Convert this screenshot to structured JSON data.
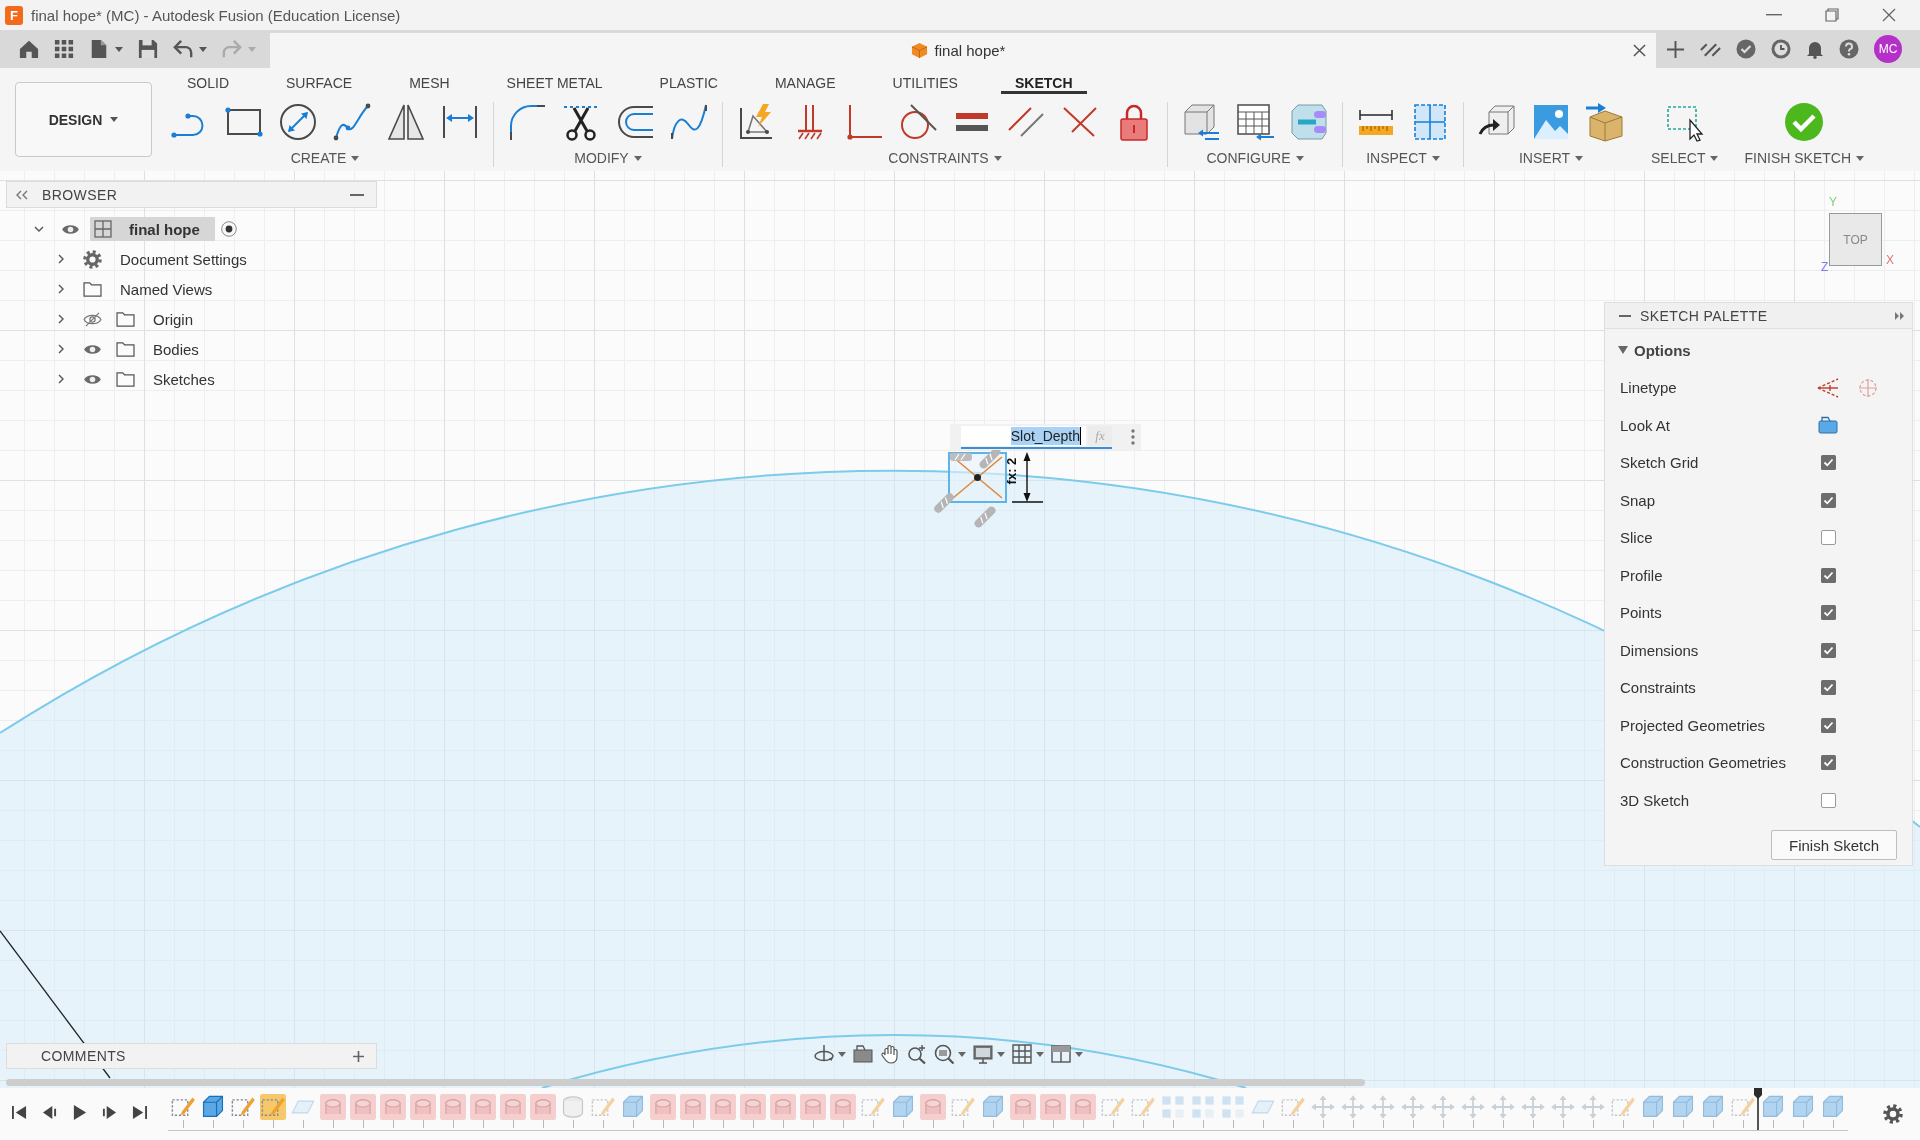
{
  "window": {
    "app_icon": "F",
    "title": "final hope* (MC) - Autodesk Fusion (Education License)"
  },
  "quick_access": [
    {
      "kind": "home",
      "dropdown": false,
      "disabled": false
    },
    {
      "kind": "apps",
      "dropdown": false,
      "disabled": false
    },
    {
      "kind": "file",
      "dropdown": true,
      "disabled": false
    },
    {
      "kind": "save",
      "dropdown": false,
      "disabled": false
    },
    {
      "kind": "undo",
      "dropdown": true,
      "disabled": false
    },
    {
      "kind": "redo",
      "dropdown": true,
      "disabled": true
    }
  ],
  "document_tab": {
    "title": "final hope*"
  },
  "user": {
    "initials": "MC"
  },
  "workspace": {
    "label": "DESIGN"
  },
  "tabs": [
    {
      "label": "SOLID",
      "selected": false
    },
    {
      "label": "SURFACE",
      "selected": false
    },
    {
      "label": "MESH",
      "selected": false
    },
    {
      "label": "SHEET METAL",
      "selected": false
    },
    {
      "label": "PLASTIC",
      "selected": false
    },
    {
      "label": "MANAGE",
      "selected": false
    },
    {
      "label": "UTILITIES",
      "selected": false
    },
    {
      "label": "SKETCH",
      "selected": true
    }
  ],
  "tool_groups": [
    {
      "label": "CREATE",
      "tools": [
        {
          "kind": "line"
        },
        {
          "kind": "rectangle"
        },
        {
          "kind": "circle"
        },
        {
          "kind": "spline"
        },
        {
          "kind": "mirror"
        },
        {
          "kind": "dimension"
        }
      ]
    },
    {
      "label": "MODIFY",
      "tools": [
        {
          "kind": "fillet"
        },
        {
          "kind": "trim"
        },
        {
          "kind": "offset"
        },
        {
          "kind": "conic"
        }
      ]
    },
    {
      "label": "CONSTRAINTS",
      "tools": [
        {
          "kind": "auto-constrain"
        },
        {
          "kind": "fix-hatch"
        },
        {
          "kind": "corner"
        },
        {
          "kind": "tangent"
        },
        {
          "kind": "equal"
        },
        {
          "kind": "parallel"
        },
        {
          "kind": "perpendicular"
        },
        {
          "kind": "lock"
        }
      ]
    },
    {
      "label": "CONFIGURE",
      "tools": [
        {
          "kind": "configure-cube"
        },
        {
          "kind": "table"
        },
        {
          "kind": "configurator"
        }
      ]
    },
    {
      "label": "INSPECT",
      "tools": [
        {
          "kind": "measure"
        },
        {
          "kind": "section"
        }
      ]
    },
    {
      "label": "INSERT",
      "tools": [
        {
          "kind": "derive"
        },
        {
          "kind": "canvas"
        },
        {
          "kind": "insert-box"
        }
      ]
    },
    {
      "label": "SELECT",
      "tools": [
        {
          "kind": "select"
        }
      ]
    },
    {
      "label": "FINISH SKETCH",
      "tools": [
        {
          "kind": "finish"
        }
      ]
    }
  ],
  "browser": {
    "title": "BROWSER",
    "tree": [
      {
        "label": "final hope",
        "kind": "component",
        "visible": true,
        "expanded": true,
        "active": true,
        "children": [
          {
            "label": "Document Settings",
            "kind": "settings",
            "expanded": false
          },
          {
            "label": "Named Views",
            "kind": "folder",
            "expanded": false
          },
          {
            "label": "Origin",
            "kind": "folder",
            "visible": false,
            "expanded": false
          },
          {
            "label": "Bodies",
            "kind": "folder",
            "visible": true,
            "expanded": false
          },
          {
            "label": "Sketches",
            "kind": "folder",
            "visible": true,
            "expanded": false
          }
        ]
      }
    ]
  },
  "view_cube": {
    "face": "TOP",
    "x_axis": "X",
    "y_axis": "Y",
    "z_axis": "Z"
  },
  "dimension_input": {
    "value": "Slot_Depth",
    "function_button": "fx"
  },
  "sketch_dimension": {
    "text": "fx: 2"
  },
  "sketch_palette": {
    "title": "SKETCH PALETTE",
    "section": {
      "label": "Options",
      "expanded": true
    },
    "rows": [
      {
        "kind": "linetype",
        "label": "Linetype"
      },
      {
        "kind": "look-at",
        "label": "Look At"
      },
      {
        "kind": "checkbox",
        "label": "Sketch Grid",
        "checked": true
      },
      {
        "kind": "checkbox",
        "label": "Snap",
        "checked": true
      },
      {
        "kind": "checkbox",
        "label": "Slice",
        "checked": false
      },
      {
        "kind": "checkbox",
        "label": "Profile",
        "checked": true
      },
      {
        "kind": "checkbox",
        "label": "Points",
        "checked": true
      },
      {
        "kind": "checkbox",
        "label": "Dimensions",
        "checked": true
      },
      {
        "kind": "checkbox",
        "label": "Constraints",
        "checked": true
      },
      {
        "kind": "checkbox",
        "label": "Projected Geometries",
        "checked": true
      },
      {
        "kind": "checkbox",
        "label": "Construction Geometries",
        "checked": true
      },
      {
        "kind": "checkbox",
        "label": "3D Sketch",
        "checked": false
      }
    ],
    "button": "Finish Sketch"
  },
  "comments": {
    "title": "COMMENTS"
  },
  "timeline": {
    "items": [
      {
        "kind": "sketch",
        "selected": false,
        "error": false
      },
      {
        "kind": "extrude",
        "selected": false,
        "error": false
      },
      {
        "kind": "sketch",
        "selected": false,
        "error": false
      },
      {
        "kind": "sketch",
        "selected": true,
        "error": false
      },
      {
        "kind": "plane",
        "selected": false,
        "error": false
      },
      {
        "kind": "revolve",
        "selected": false,
        "error": true
      },
      {
        "kind": "revolve",
        "selected": false,
        "error": true
      },
      {
        "kind": "revolve",
        "selected": false,
        "error": true
      },
      {
        "kind": "revolve",
        "selected": false,
        "error": true
      },
      {
        "kind": "revolve",
        "selected": false,
        "error": true
      },
      {
        "kind": "revolve",
        "selected": false,
        "error": true
      },
      {
        "kind": "revolve",
        "selected": false,
        "error": true
      },
      {
        "kind": "revolve",
        "selected": false,
        "error": true
      },
      {
        "kind": "hole",
        "selected": false,
        "error": false
      },
      {
        "kind": "sketch",
        "selected": false,
        "error": false
      },
      {
        "kind": "extrude",
        "selected": false,
        "error": false
      },
      {
        "kind": "revolve",
        "selected": false,
        "error": true
      },
      {
        "kind": "revolve",
        "selected": false,
        "error": true
      },
      {
        "kind": "revolve",
        "selected": false,
        "error": true
      },
      {
        "kind": "revolve",
        "selected": false,
        "error": true
      },
      {
        "kind": "revolve",
        "selected": false,
        "error": true
      },
      {
        "kind": "revolve",
        "selected": false,
        "error": true
      },
      {
        "kind": "revolve",
        "selected": false,
        "error": true
      },
      {
        "kind": "sketch",
        "selected": false,
        "error": false
      },
      {
        "kind": "extrude",
        "selected": false,
        "error": false
      },
      {
        "kind": "revolve",
        "selected": false,
        "error": true
      },
      {
        "kind": "sketch",
        "selected": false,
        "error": false
      },
      {
        "kind": "extrude",
        "selected": false,
        "error": false
      },
      {
        "kind": "revolve",
        "selected": false,
        "error": true
      },
      {
        "kind": "revolve",
        "selected": false,
        "error": true
      },
      {
        "kind": "revolve",
        "selected": false,
        "error": true
      },
      {
        "kind": "sketch",
        "selected": false,
        "error": false
      },
      {
        "kind": "sketch",
        "selected": false,
        "error": false
      },
      {
        "kind": "pattern",
        "selected": false,
        "error": false
      },
      {
        "kind": "pattern",
        "selected": false,
        "error": false
      },
      {
        "kind": "pattern",
        "selected": false,
        "error": false
      },
      {
        "kind": "plane",
        "selected": false,
        "error": false
      },
      {
        "kind": "sketch",
        "selected": false,
        "error": false
      },
      {
        "kind": "move",
        "selected": false,
        "error": false
      },
      {
        "kind": "move",
        "selected": false,
        "error": false
      },
      {
        "kind": "move",
        "selected": false,
        "error": false
      },
      {
        "kind": "move",
        "selected": false,
        "error": false
      },
      {
        "kind": "move",
        "selected": false,
        "error": false
      },
      {
        "kind": "move",
        "selected": false,
        "error": false
      },
      {
        "kind": "move",
        "selected": false,
        "error": false
      },
      {
        "kind": "move",
        "selected": false,
        "error": false
      },
      {
        "kind": "move",
        "selected": false,
        "error": false
      },
      {
        "kind": "move",
        "selected": false,
        "error": false
      },
      {
        "kind": "sketch",
        "selected": false,
        "error": false
      },
      {
        "kind": "extrude",
        "selected": false,
        "error": false
      },
      {
        "kind": "extrude",
        "selected": false,
        "error": false
      },
      {
        "kind": "extrude",
        "selected": false,
        "error": false
      },
      {
        "kind": "sketch",
        "selected": false,
        "error": false
      },
      {
        "kind": "marker",
        "selected": false,
        "error": false
      },
      {
        "kind": "extrude",
        "selected": false,
        "error": false
      },
      {
        "kind": "extrude",
        "selected": false,
        "error": false
      },
      {
        "kind": "extrude",
        "selected": false,
        "error": false
      }
    ]
  }
}
